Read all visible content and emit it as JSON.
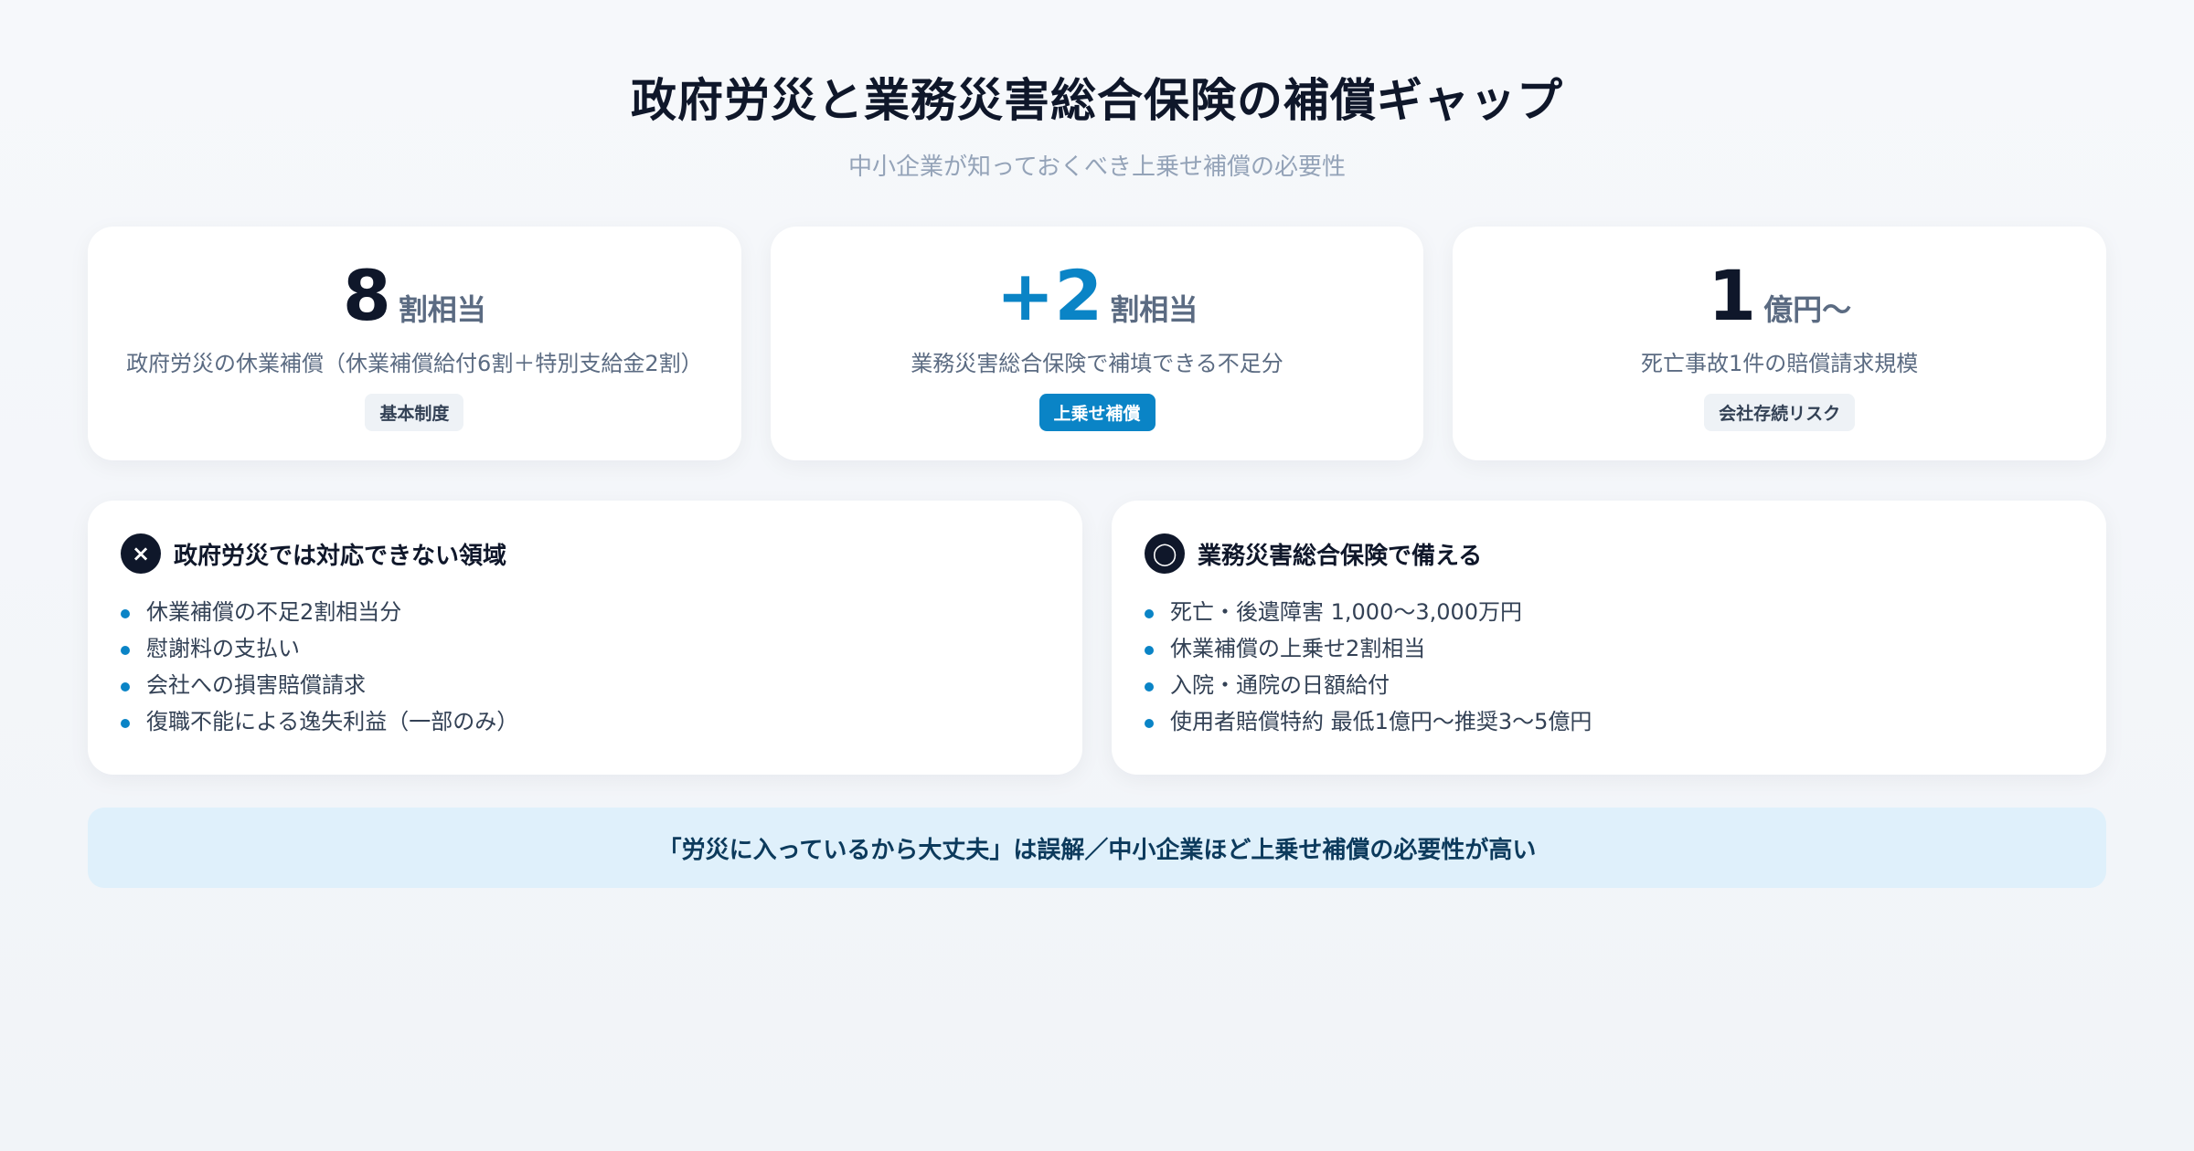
{
  "header": {
    "title": "政府労災と業務災害総合保険の補償ギャップ",
    "subtitle": "中小企業が知っておくべき上乗せ補償の必要性"
  },
  "stats": [
    {
      "value": "8",
      "unit": "割相当",
      "description": "政府労災の休業補償（休業補償給付6割＋特別支給金2割）",
      "tag": "基本制度"
    },
    {
      "value": "+2",
      "unit": "割相当",
      "description": "業務災害総合保険で補填できる不足分",
      "tag": "上乗せ補償"
    },
    {
      "value": "1",
      "unit": "億円〜",
      "description": "死亡事故1件の賠償請求規模",
      "tag": "会社存続リスク"
    }
  ],
  "panels": {
    "left": {
      "icon": "×",
      "icon_name": "cross-icon",
      "title": "政府労災では対応できない領域",
      "items": [
        "休業補償の不足2割相当分",
        "慰謝料の支払い",
        "会社への損害賠償請求",
        "復職不能による逸失利益（一部のみ）"
      ]
    },
    "right": {
      "icon": "◯",
      "icon_name": "circle-icon",
      "title": "業務災害総合保険で備える",
      "items": [
        "死亡・後遺障害 1,000〜3,000万円",
        "休業補償の上乗せ2割相当",
        "入院・通院の日額給付",
        "使用者賠償特約 最低1億円〜推奨3〜5億円"
      ]
    }
  },
  "banner": {
    "text": "「労災に入っているから大丈夫」は誤解／中小企業ほど上乗せ補償の必要性が高い"
  },
  "colors": {
    "accent": "#0a84c6",
    "text_primary": "#0f172a",
    "banner_bg": "#dff0fb"
  }
}
